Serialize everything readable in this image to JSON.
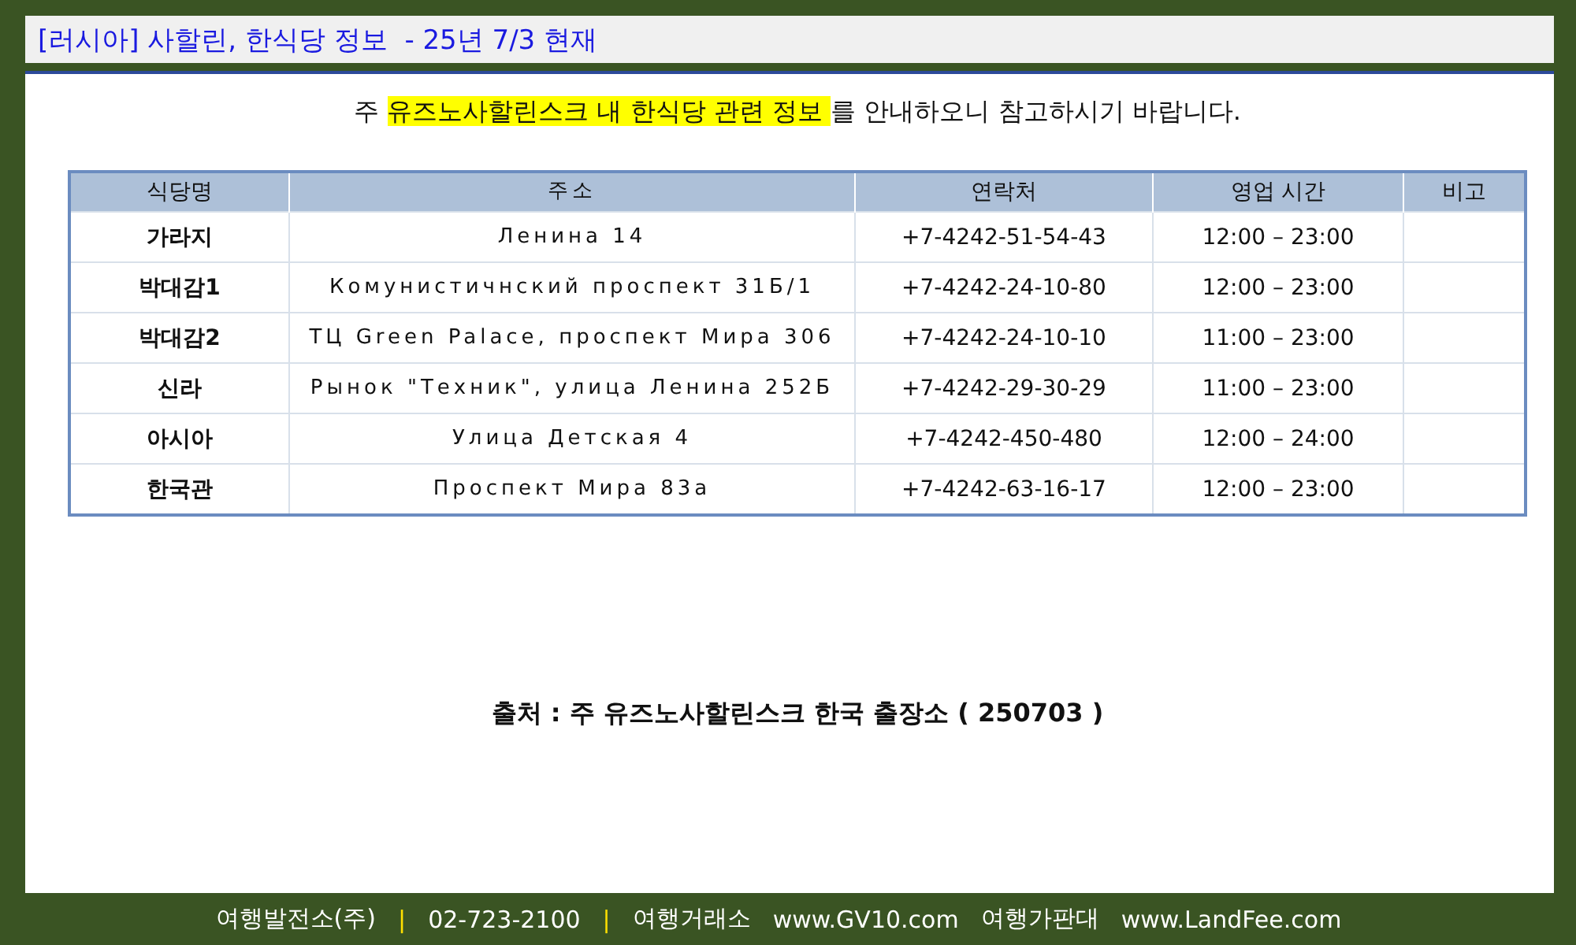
{
  "title": "[러시아] 사할린, 한식당 정보  - 25년 7/3 현재",
  "intro": [
    {
      "text": "주 ",
      "highlighted": false
    },
    {
      "text": "유즈노사할린스크 내 한식당 관련 정보 ",
      "highlighted": true
    },
    {
      "text": "를 안내하오니 참고하시기 바랍니다.",
      "highlighted": false
    }
  ],
  "table": {
    "columns": [
      "식당명",
      "주소",
      "연락처",
      "영업 시간",
      "비고"
    ],
    "rows": [
      [
        "가라지",
        "Ленина 14",
        "+7-4242-51-54-43",
        "12:00 – 23:00"
      ],
      [
        "박대감1",
        "Комунистичнский проспект 31Б/1",
        "+7-4242-24-10-80",
        "12:00 – 23:00"
      ],
      [
        "박대감2",
        "ТЦ Green Palace, проспект Мира 306",
        "+7-4242-24-10-10",
        "11:00 – 23:00"
      ],
      [
        "신라",
        "Рынок \"Техник\", улица Ленина 252Б",
        "+7-4242-29-30-29",
        "11:00 – 23:00"
      ],
      [
        "아시아",
        "Улица Детская 4",
        "+7-4242-450-480",
        "12:00 – 24:00"
      ],
      [
        "한국관",
        "Проспект Мира 83а",
        "+7-4242-63-16-17",
        "12:00 – 23:00"
      ]
    ]
  },
  "source": "출처 : 주 유즈노사할린스크 한국 출장소 ( 250703 )",
  "footer": [
    {
      "kind": "text",
      "text": "여행발전소(주)"
    },
    {
      "kind": "divider",
      "text": "|"
    },
    {
      "kind": "text",
      "text": "02-723-2100"
    },
    {
      "kind": "divider",
      "text": "|"
    },
    {
      "kind": "text",
      "text": "여행거래소"
    },
    {
      "kind": "text",
      "text": "www.GV10.com"
    },
    {
      "kind": "text",
      "text": "여행가판대"
    },
    {
      "kind": "text",
      "text": "www.LandFee.com"
    }
  ]
}
